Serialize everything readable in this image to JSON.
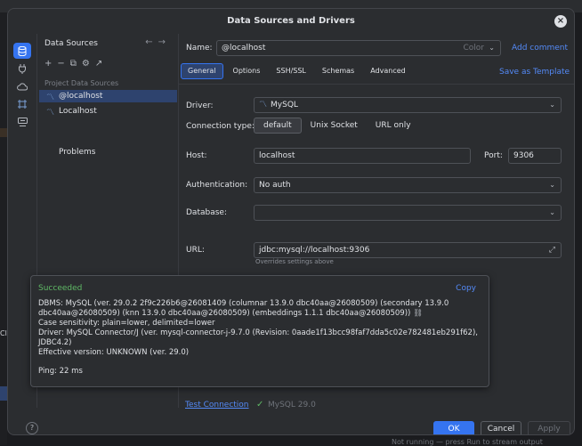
{
  "dialog": {
    "title": "Data Sources and Drivers",
    "close_glyph": "×"
  },
  "rail": {
    "icons": [
      "database-icon",
      "plug-icon",
      "cloud-icon",
      "frame-icon",
      "driver-icon"
    ]
  },
  "left_panel": {
    "title": "Data Sources",
    "section": "Project Data Sources",
    "items": [
      {
        "label": "@localhost",
        "selected": true
      },
      {
        "label": "Localhost",
        "selected": false
      }
    ],
    "problems": "Problems"
  },
  "form": {
    "name_label": "Name:",
    "name_value": "@localhost",
    "color_placeholder": "Color",
    "add_comment": "Add comment",
    "save_template": "Save as Template",
    "tabs": [
      "General",
      "Options",
      "SSH/SSL",
      "Schemas",
      "Advanced"
    ],
    "active_tab": "General",
    "driver_label": "Driver:",
    "driver_value": "MySQL",
    "conn_type_label": "Connection type:",
    "conn_types": [
      "default",
      "Unix Socket",
      "URL only"
    ],
    "host_label": "Host:",
    "host_value": "localhost",
    "port_label": "Port:",
    "port_value": "9306",
    "auth_label": "Authentication:",
    "auth_value": "No auth",
    "db_label": "Database:",
    "db_value": "",
    "url_label": "URL:",
    "url_value": "jdbc:mysql://localhost:9306",
    "url_hint": "Overrides settings above"
  },
  "popup": {
    "status": "Succeeded",
    "copy": "Copy",
    "lines": [
      "DBMS: MySQL (ver. 29.0.2 2f9c226b6@26081409 (columnar 13.9.0 dbc40aa@26080509) (secondary 13.9.0",
      "dbc40aa@26080509) (knn 13.9.0 dbc40aa@26080509) (embeddings 1.1.1 dbc40aa@26080509))",
      "Case sensitivity: plain=lower, delimited=lower",
      "Driver: MySQL Connector/J (ver. mysql-connector-j-9.7.0 (Revision: 0aade1f13bcc98faf7dda5c02e782481eb291f62),",
      "JDBC4.2)",
      "Effective version: UNKNOWN (ver. 29.0)"
    ],
    "ping": "Ping: 22 ms"
  },
  "test": {
    "link": "Test Connection",
    "version": "MySQL 29.0"
  },
  "footer": {
    "help": "?",
    "ok": "OK",
    "cancel": "Cancel",
    "apply": "Apply"
  },
  "background": {
    "left_text": "Clc",
    "bottom_text": "Not running — press Run to stream output"
  }
}
